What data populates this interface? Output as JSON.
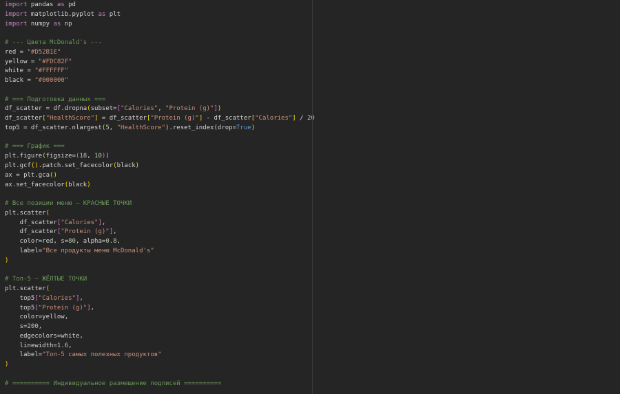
{
  "editor": {
    "lines": [
      [
        [
          "kw",
          "import"
        ],
        [
          "tx",
          " pandas "
        ],
        [
          "kw",
          "as"
        ],
        [
          "tx",
          " pd"
        ]
      ],
      [
        [
          "kw",
          "import"
        ],
        [
          "tx",
          " matplotlib.pyplot "
        ],
        [
          "kw",
          "as"
        ],
        [
          "tx",
          " plt"
        ]
      ],
      [
        [
          "kw",
          "import"
        ],
        [
          "tx",
          " numpy "
        ],
        [
          "kw",
          "as"
        ],
        [
          "tx",
          " np"
        ]
      ],
      [],
      [
        [
          "cm",
          "# --- Цвета McDonald's ---"
        ]
      ],
      [
        [
          "tx",
          "red = "
        ],
        [
          "str",
          "\"#D52B1E\""
        ]
      ],
      [
        [
          "tx",
          "yellow = "
        ],
        [
          "str",
          "\"#FDC82F\""
        ]
      ],
      [
        [
          "tx",
          "white = "
        ],
        [
          "str",
          "\"#FFFFFF\""
        ]
      ],
      [
        [
          "tx",
          "black = "
        ],
        [
          "str",
          "\"#000000\""
        ]
      ],
      [],
      [
        [
          "cm",
          "# === Подготовка данных ==="
        ]
      ],
      [
        [
          "tx",
          "df_scatter = df.dropna"
        ],
        [
          "b1",
          "("
        ],
        [
          "tx",
          "subset="
        ],
        [
          "b2",
          "["
        ],
        [
          "str",
          "\"Calories\""
        ],
        [
          "tx",
          ", "
        ],
        [
          "str",
          "\"Protein (g)\""
        ],
        [
          "b2",
          "]"
        ],
        [
          "b1",
          ")"
        ]
      ],
      [
        [
          "tx",
          "df_scatter"
        ],
        [
          "b1",
          "["
        ],
        [
          "str",
          "\"HealthScore\""
        ],
        [
          "b1",
          "]"
        ],
        [
          "tx",
          " = df_scatter"
        ],
        [
          "b1",
          "["
        ],
        [
          "str",
          "\"Protein (g)\""
        ],
        [
          "b1",
          "]"
        ],
        [
          "tx",
          " - df_scatter"
        ],
        [
          "b1",
          "["
        ],
        [
          "str",
          "\"Calories\""
        ],
        [
          "b1",
          "]"
        ],
        [
          "tx",
          " / "
        ],
        [
          "num",
          "20"
        ]
      ],
      [
        [
          "tx",
          "top5 = df_scatter.nlargest"
        ],
        [
          "b1",
          "("
        ],
        [
          "num",
          "5"
        ],
        [
          "tx",
          ", "
        ],
        [
          "str",
          "\"HealthScore\""
        ],
        [
          "b1",
          ")"
        ],
        [
          "tx",
          ".reset_index"
        ],
        [
          "b1",
          "("
        ],
        [
          "tx",
          "drop="
        ],
        [
          "const",
          "True"
        ],
        [
          "b1",
          ")"
        ]
      ],
      [],
      [
        [
          "cm",
          "# === График ==="
        ]
      ],
      [
        [
          "tx",
          "plt.figure"
        ],
        [
          "b1",
          "("
        ],
        [
          "tx",
          "figsize="
        ],
        [
          "b2",
          "("
        ],
        [
          "num",
          "18"
        ],
        [
          "tx",
          ", "
        ],
        [
          "num",
          "10"
        ],
        [
          "b2",
          ")"
        ],
        [
          "b1",
          ")"
        ]
      ],
      [
        [
          "tx",
          "plt.gcf"
        ],
        [
          "b1",
          "()"
        ],
        [
          "tx",
          ".patch.set_facecolor"
        ],
        [
          "b1",
          "("
        ],
        [
          "tx",
          "black"
        ],
        [
          "b1",
          ")"
        ]
      ],
      [
        [
          "tx",
          "ax = plt.gca"
        ],
        [
          "b1",
          "()"
        ]
      ],
      [
        [
          "tx",
          "ax.set_facecolor"
        ],
        [
          "b1",
          "("
        ],
        [
          "tx",
          "black"
        ],
        [
          "b1",
          ")"
        ]
      ],
      [],
      [
        [
          "cm",
          "# Все позиции меню — КРАСНЫЕ ТОЧКИ"
        ]
      ],
      [
        [
          "tx",
          "plt.scatter"
        ],
        [
          "b1",
          "("
        ]
      ],
      [
        [
          "tx",
          "    df_scatter"
        ],
        [
          "b2",
          "["
        ],
        [
          "str",
          "\"Calories\""
        ],
        [
          "b2",
          "]"
        ],
        [
          "tx",
          ","
        ]
      ],
      [
        [
          "tx",
          "    df_scatter"
        ],
        [
          "b2",
          "["
        ],
        [
          "str",
          "\"Protein (g)\""
        ],
        [
          "b2",
          "]"
        ],
        [
          "tx",
          ","
        ]
      ],
      [
        [
          "tx",
          "    color=red, s="
        ],
        [
          "num",
          "80"
        ],
        [
          "tx",
          ", alpha="
        ],
        [
          "num",
          "0.8"
        ],
        [
          "tx",
          ","
        ]
      ],
      [
        [
          "tx",
          "    label="
        ],
        [
          "str",
          "\"Все продукты меню McDonald's\""
        ]
      ],
      [
        [
          "b1",
          ")"
        ]
      ],
      [],
      [
        [
          "cm",
          "# Топ-5 — ЖЁЛТЫЕ ТОЧКИ"
        ]
      ],
      [
        [
          "tx",
          "plt.scatter"
        ],
        [
          "b1",
          "("
        ]
      ],
      [
        [
          "tx",
          "    top5"
        ],
        [
          "b2",
          "["
        ],
        [
          "str",
          "\"Calories\""
        ],
        [
          "b2",
          "]"
        ],
        [
          "tx",
          ","
        ]
      ],
      [
        [
          "tx",
          "    top5"
        ],
        [
          "b2",
          "["
        ],
        [
          "str",
          "\"Protein (g)\""
        ],
        [
          "b2",
          "]"
        ],
        [
          "tx",
          ","
        ]
      ],
      [
        [
          "tx",
          "    color=yellow,"
        ]
      ],
      [
        [
          "tx",
          "    s="
        ],
        [
          "num",
          "200"
        ],
        [
          "tx",
          ","
        ]
      ],
      [
        [
          "tx",
          "    edgecolors=white,"
        ]
      ],
      [
        [
          "tx",
          "    linewidth="
        ],
        [
          "num",
          "1.6"
        ],
        [
          "tx",
          ","
        ]
      ],
      [
        [
          "tx",
          "    label="
        ],
        [
          "str",
          "\"Топ-5 самых полезных продуктов\""
        ]
      ],
      [
        [
          "b1",
          ")"
        ]
      ],
      [],
      [
        [
          "cm",
          "# ========== Индивидуальное размещение подписей =========="
        ]
      ]
    ]
  }
}
